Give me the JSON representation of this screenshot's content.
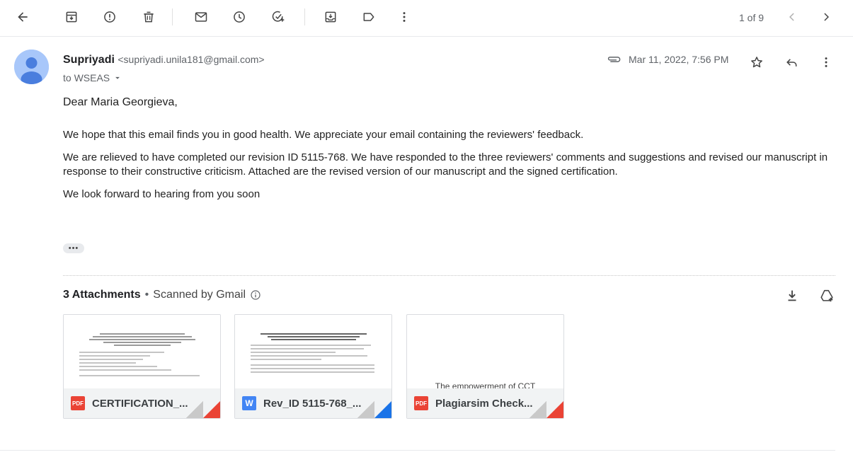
{
  "toolbar": {
    "pager_text": "1 of 9"
  },
  "message": {
    "sender_name": "Supriyadi",
    "sender_email": "<supriyadi.unila181@gmail.com>",
    "to_line": "to WSEAS",
    "timestamp": "Mar 11, 2022, 7:56 PM",
    "greeting": "Dear Maria Georgieva,",
    "paragraphs": [
      "We hope that this email finds you in good health. We appreciate your email containing the reviewers' feedback.",
      "We are relieved to have completed our revision ID 5115-768. We have responded to the three reviewers' comments and suggestions and revised our manuscript in response to their constructive criticism. Attached are the revised version of our manuscript and the signed certification.",
      "We look forward to hearing from you soon"
    ]
  },
  "attachments": {
    "count_label": "3 Attachments",
    "separator": "•",
    "scan_label": "Scanned by Gmail",
    "items": [
      {
        "name": "CERTIFICATION_...",
        "type": "PDF",
        "type_color": "#ea4335"
      },
      {
        "name": "Rev_ID 5115-768_...",
        "type": "W",
        "type_color": "#4285f4"
      },
      {
        "name": "Plagiarsim Check...",
        "type": "PDF",
        "type_color": "#ea4335",
        "preview_text": "The empowerment of CCT"
      }
    ]
  },
  "colors": {
    "pdf_red": "#ea4335",
    "word_blue": "#1a73e8",
    "avatar_bg": "#a8c7fa",
    "avatar_fg": "#4a7ede"
  }
}
